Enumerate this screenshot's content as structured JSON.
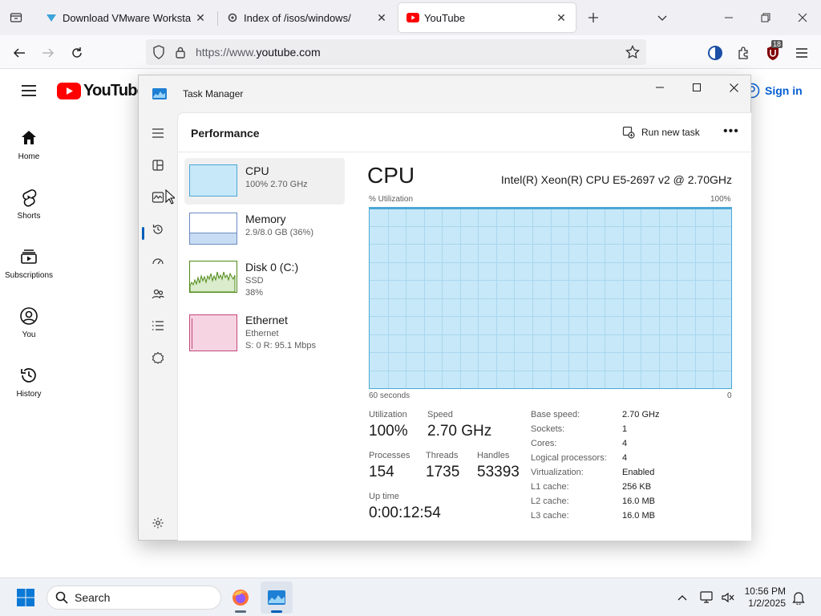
{
  "browser": {
    "tabs": [
      {
        "title": "Download VMware Workstation",
        "favicon": "vmware-icon"
      },
      {
        "title": "Index of /isos/windows/",
        "favicon": "gear-icon"
      },
      {
        "title": "YouTube",
        "favicon": "youtube-icon",
        "active": true
      }
    ],
    "url_prefix": "https://www.",
    "url_domain": "youtube.com",
    "extension_badge": "18"
  },
  "youtube": {
    "logo_text": "YouTube",
    "sign_in": "Sign in",
    "nav": [
      {
        "label": "Home",
        "icon": "home-icon"
      },
      {
        "label": "Shorts",
        "icon": "shorts-icon"
      },
      {
        "label": "Subscriptions",
        "icon": "subscriptions-icon"
      },
      {
        "label": "You",
        "icon": "you-icon"
      },
      {
        "label": "History",
        "icon": "history-icon"
      }
    ]
  },
  "task_manager": {
    "title": "Task Manager",
    "page_title": "Performance",
    "run_new_task": "Run new task",
    "more": "•••",
    "resources": [
      {
        "name": "CPU",
        "line1": "100%  2.70 GHz",
        "line2": ""
      },
      {
        "name": "Memory",
        "line1": "2.9/8.0 GB (36%)",
        "line2": ""
      },
      {
        "name": "Disk 0 (C:)",
        "line1": "SSD",
        "line2": "38%"
      },
      {
        "name": "Ethernet",
        "line1": "Ethernet",
        "line2": "S: 0  R: 95.1 Mbps"
      }
    ],
    "detail": {
      "heading": "CPU",
      "model": "Intel(R) Xeon(R) CPU E5-2697 v2 @ 2.70GHz",
      "graph_top_left": "% Utilization",
      "graph_top_right": "100%",
      "graph_bottom_left": "60 seconds",
      "graph_bottom_right": "0",
      "utilization_percent": 100,
      "stats": {
        "utilization_label": "Utilization",
        "utilization": "100%",
        "speed_label": "Speed",
        "speed": "2.70 GHz",
        "processes_label": "Processes",
        "processes": "154",
        "threads_label": "Threads",
        "threads": "1735",
        "handles_label": "Handles",
        "handles": "53393",
        "uptime_label": "Up time",
        "uptime": "0:00:12:54"
      },
      "specs": [
        {
          "label": "Base speed:",
          "value": "2.70 GHz"
        },
        {
          "label": "Sockets:",
          "value": "1"
        },
        {
          "label": "Cores:",
          "value": "4"
        },
        {
          "label": "Logical processors:",
          "value": "4"
        },
        {
          "label": "Virtualization:",
          "value": "Enabled"
        },
        {
          "label": "L1 cache:",
          "value": "256 KB"
        },
        {
          "label": "L2 cache:",
          "value": "16.0 MB"
        },
        {
          "label": "L3 cache:",
          "value": "16.0 MB"
        }
      ]
    }
  },
  "taskbar": {
    "search_placeholder": "Search",
    "time": "10:56 PM",
    "date": "1/2/2025"
  },
  "colors": {
    "cpu_fill": "#c7e8f8",
    "cpu_border": "#4aa7d6",
    "disk_fill": "#e4f2d6",
    "disk_line": "#4e8a16",
    "net_fill": "#f7d4e1",
    "net_line": "#c2477a",
    "yt_red": "#ff0000",
    "accent": "#005fb8"
  }
}
